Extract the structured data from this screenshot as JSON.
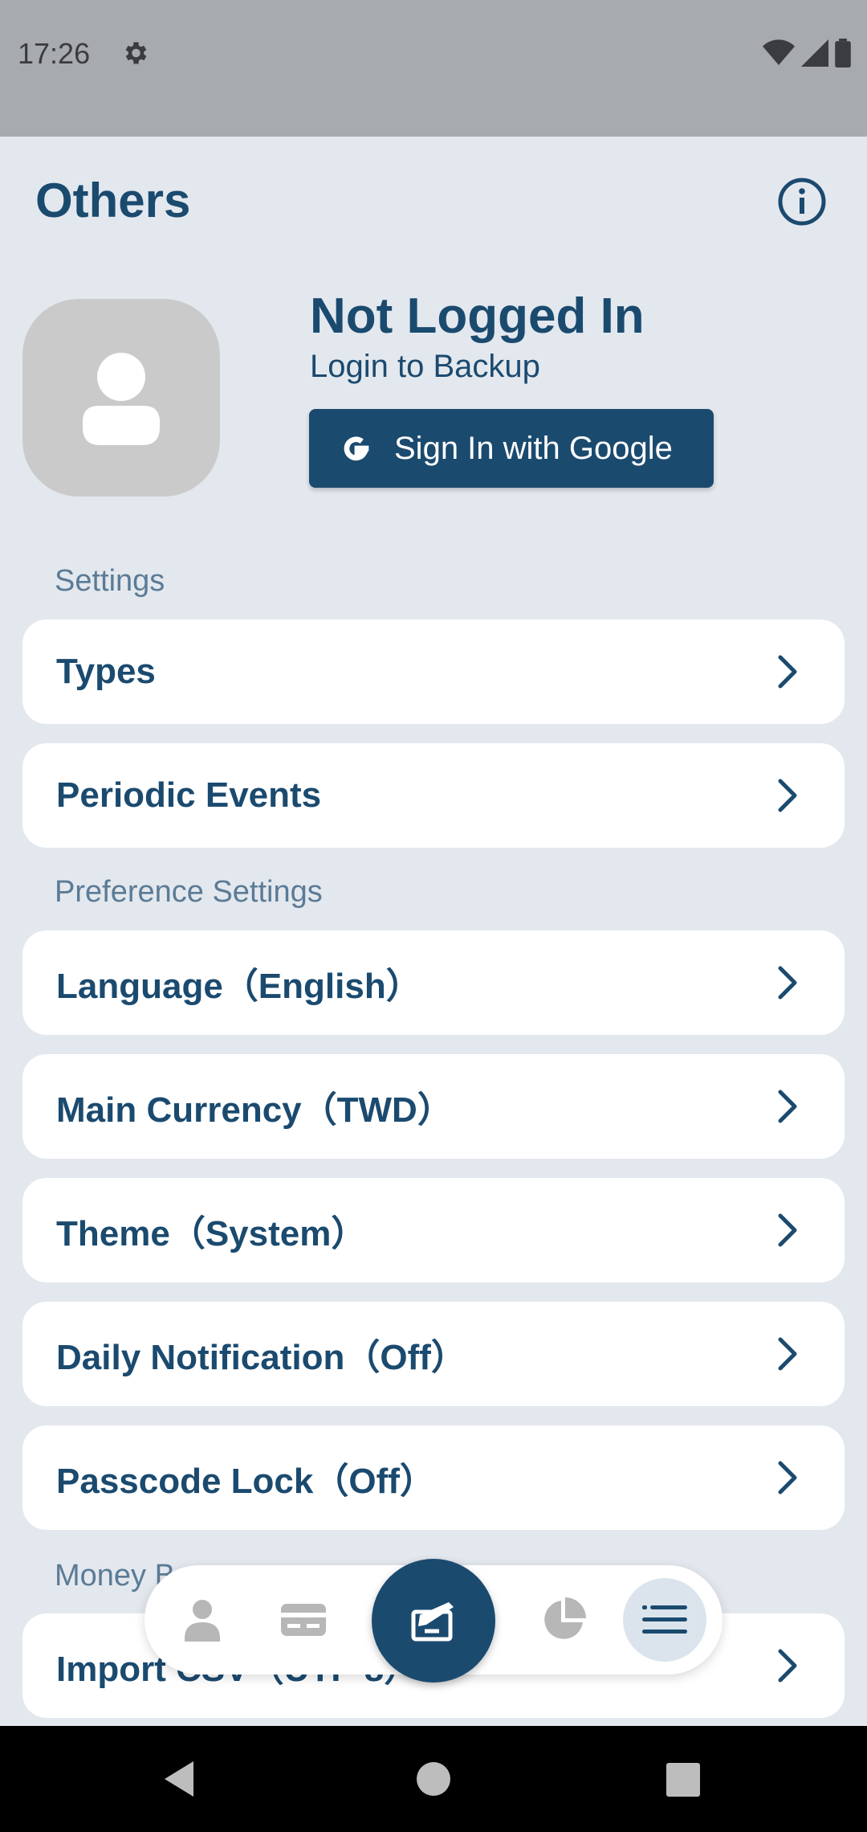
{
  "status_bar": {
    "time": "17:26",
    "icons": [
      "gear-icon",
      "wifi-icon",
      "signal-icon",
      "battery-icon"
    ]
  },
  "header": {
    "title": "Others",
    "info_icon": "info-icon"
  },
  "profile": {
    "title": "Not Logged In",
    "subtitle": "Login to Backup",
    "google_button_label": "Sign In with Google"
  },
  "sections": {
    "settings": "Settings",
    "preference": "Preference Settings",
    "money": "Money B"
  },
  "menu": {
    "types": "Types",
    "periodic_events": "Periodic Events",
    "language": "Language（English）",
    "main_currency": "Main Currency（TWD）",
    "theme": "Theme（System）",
    "daily_notification": "Daily Notification（Off）",
    "passcode_lock": "Passcode Lock（Off）",
    "import_csv": "Import CSV（UTF-8）"
  },
  "bottom_nav": {
    "items": [
      "person-icon",
      "card-icon",
      "add-record-icon",
      "pie-chart-icon",
      "menu-icon"
    ],
    "active": "menu-icon"
  },
  "colors": {
    "primary": "#1b4a6f",
    "background": "#e3e8ee",
    "card": "#ffffff",
    "section_label": "#5b7b96"
  }
}
